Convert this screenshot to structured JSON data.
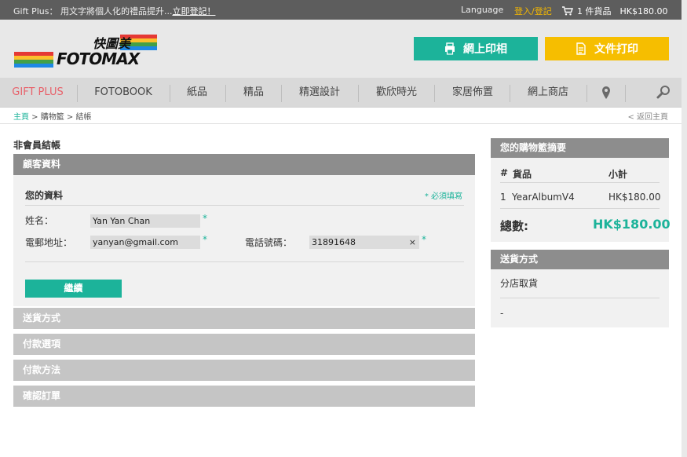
{
  "topbar": {
    "promo_text": "Gift Plus： 用文字將個人化的禮品提升...",
    "promo_link": "立即登記！",
    "language": "Language",
    "login": "登入/登記",
    "cart_count": "1 件貨品",
    "cart_total": "HK$180.00"
  },
  "header": {
    "logo_chinese": "快圖美",
    "logo_brand": "FOTOMAX",
    "btn_online_print": "網上印相",
    "btn_document_print": "文件打印"
  },
  "nav": {
    "items": [
      "GIFT PLUS",
      "FOTOBOOK",
      "紙品",
      "精品",
      "精選設計",
      "歡欣時光",
      "家居佈置",
      "網上商店"
    ]
  },
  "breadcrumb": {
    "home": "主頁",
    "sep1": " > ",
    "cart": "購物籃",
    "sep2": " > ",
    "current": "結帳",
    "back": "< 返回主頁"
  },
  "checkout": {
    "page_title": "非會員結帳",
    "customer_section": "顧客資料",
    "your_info": "您的資料",
    "required_note": "* 必須填寫",
    "name_label": "姓名：",
    "name_value": "Yan Yan Chan",
    "email_label": "電郵地址：",
    "email_value": "yanyan@gmail.com",
    "phone_label": "電話號碼：",
    "phone_value": "31891648",
    "required_star": "*",
    "clear_symbol": "×",
    "continue_label": "繼續",
    "sections": [
      "送貨方式",
      "付款選項",
      "付款方法",
      "確認訂單"
    ]
  },
  "summary": {
    "title": "您的購物籃摘要",
    "col_num": "#",
    "col_item": "貨品",
    "col_subtotal": "小計",
    "row_num": "1",
    "row_item": "YearAlbumV4",
    "row_subtotal": "HK$180.00",
    "total_label": "總數:",
    "total_value": "HK$180.00",
    "delivery_title": "送貨方式",
    "delivery_value": "分店取貨",
    "delivery_extra": "-"
  },
  "colors": {
    "accent_teal": "#1cb39a",
    "accent_yellow": "#f6be00",
    "nav_active": "#e8616a"
  }
}
